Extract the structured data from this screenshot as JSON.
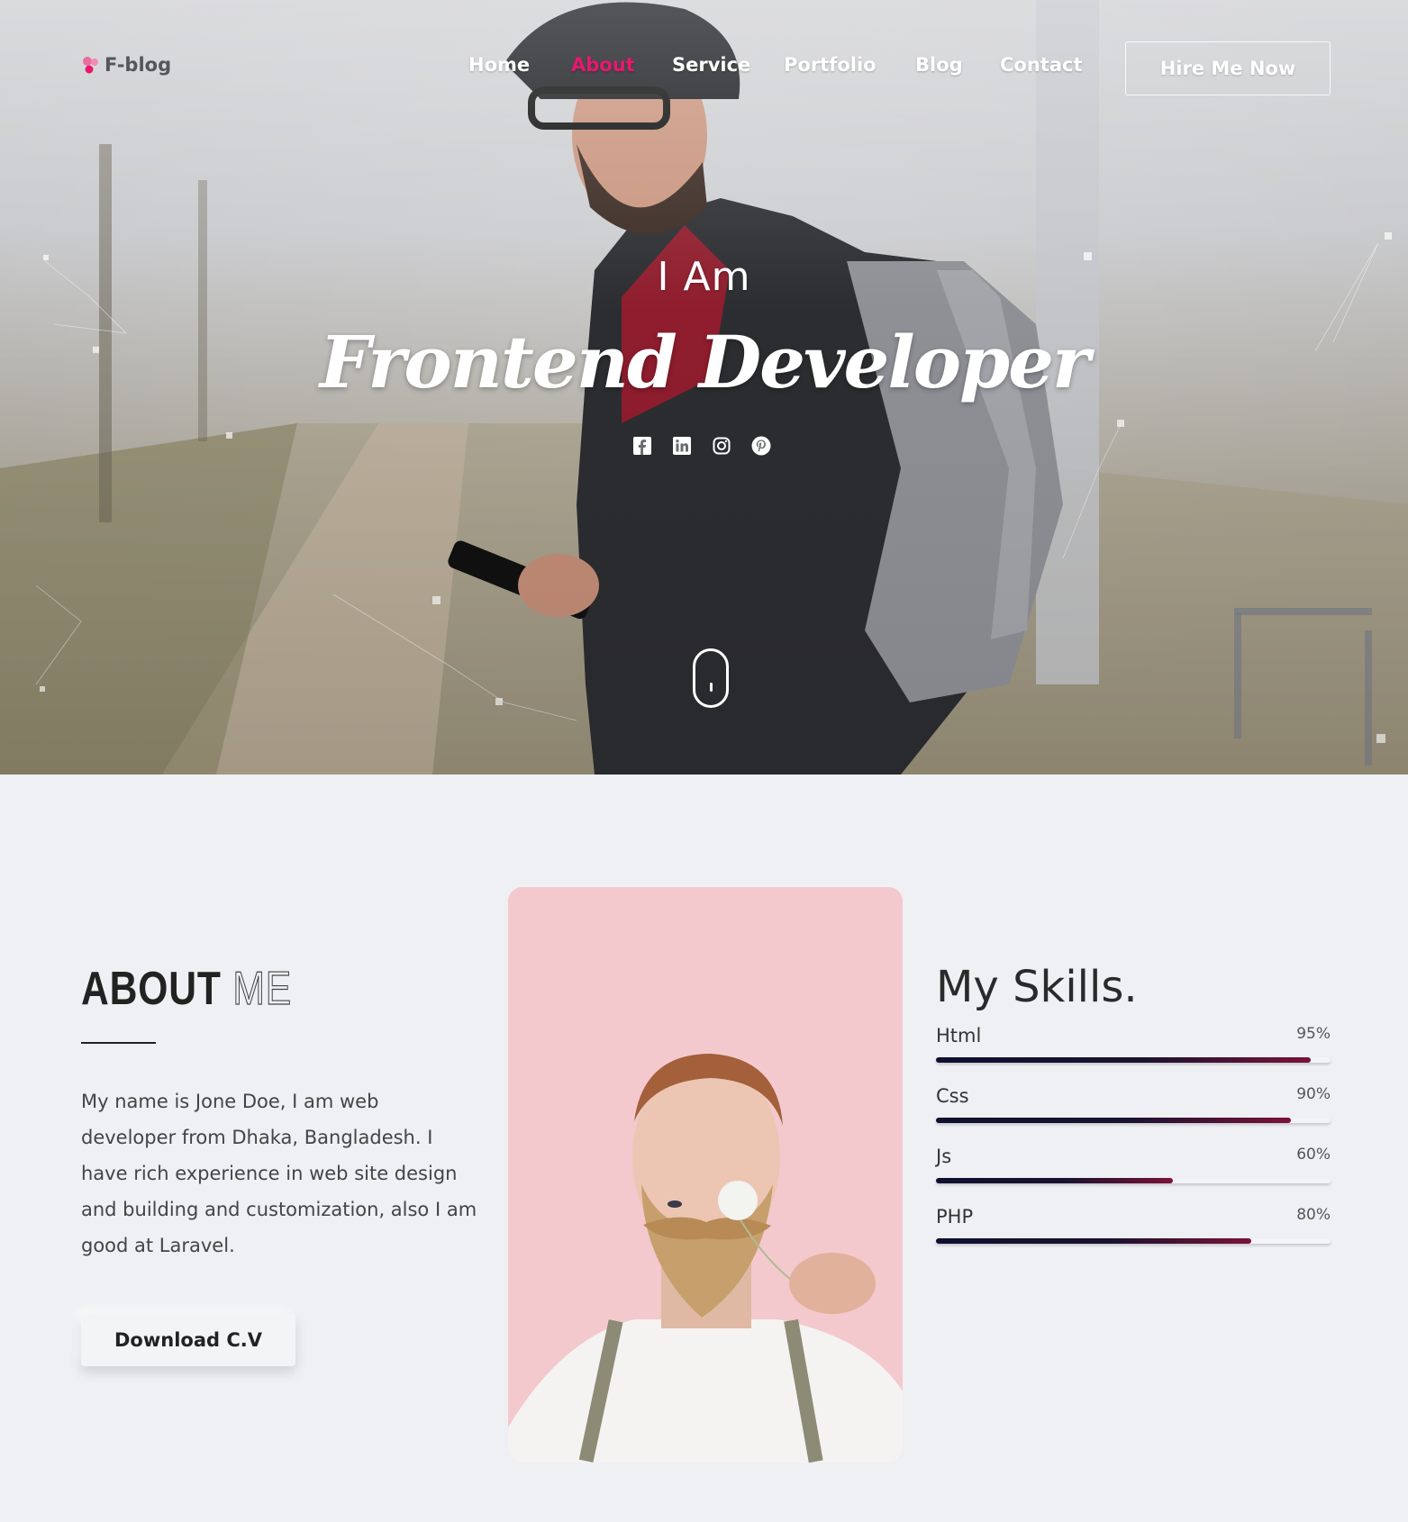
{
  "brand": {
    "name": "F-blog",
    "accent": "#e6196e"
  },
  "nav": {
    "items": [
      {
        "label": "Home",
        "active": false
      },
      {
        "label": "About",
        "active": true
      },
      {
        "label": "Service",
        "active": false
      },
      {
        "label": "Portfolio",
        "active": false
      },
      {
        "label": "Blog",
        "active": false
      },
      {
        "label": "Contact",
        "active": false
      }
    ],
    "cta": "Hire Me Now"
  },
  "hero": {
    "intro": "I Am",
    "role": "Frontend Developer",
    "social_icons": [
      "facebook-icon",
      "linkedin-icon",
      "instagram-icon",
      "pinterest-icon"
    ]
  },
  "about": {
    "title_bold": "ABOUT",
    "title_outline": "ME",
    "text": "My name is Jone Doe, I am web developer from Dhaka, Bangladesh. I have rich experience in web site design and building and customization, also I am good at Laravel.",
    "button": "Download C.V"
  },
  "skills": {
    "title": "My Skills.",
    "items": [
      {
        "name": "Html",
        "percent_label": "95%",
        "value": 0.95
      },
      {
        "name": "Css",
        "percent_label": "90%",
        "value": 0.9
      },
      {
        "name": "Js",
        "percent_label": "60%",
        "value": 0.6
      },
      {
        "name": "PHP",
        "percent_label": "80%",
        "value": 0.8
      }
    ]
  }
}
